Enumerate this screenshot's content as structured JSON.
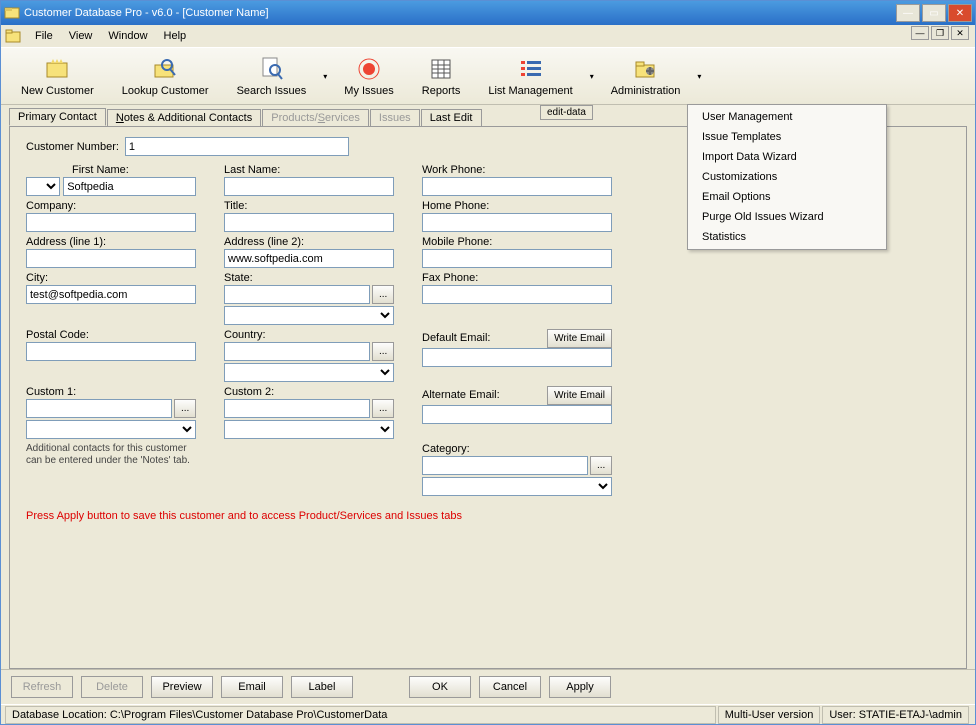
{
  "title": "Customer Database Pro - v6.0 - [Customer Name]",
  "menu": {
    "file": "File",
    "view": "View",
    "window": "Window",
    "help": "Help"
  },
  "toolbar": {
    "new_customer": "New Customer",
    "lookup_customer": "Lookup Customer",
    "search_issues": "Search Issues",
    "my_issues": "My Issues",
    "reports": "Reports",
    "list_management": "List Management",
    "administration": "Administration"
  },
  "tabs": {
    "primary": "Primary Contact",
    "notes": "Notes & Additional Contacts",
    "products": "Products/Services",
    "issues": "Issues",
    "last_edit": "Last Edit",
    "edit_data": "edit-data"
  },
  "admin_menu": {
    "user_mgmt": "User Management",
    "issue_templates": "Issue Templates",
    "import_wizard": "Import Data Wizard",
    "customizations": "Customizations",
    "email_options": "Email Options",
    "purge": "Purge Old Issues Wizard",
    "statistics": "Statistics"
  },
  "labels": {
    "customer_number": "Customer Number:",
    "first_name": "First Name:",
    "last_name": "Last Name:",
    "work_phone": "Work Phone:",
    "company": "Company:",
    "title": "Title:",
    "home_phone": "Home Phone:",
    "address1": "Address (line 1):",
    "address2": "Address (line 2):",
    "mobile_phone": "Mobile Phone:",
    "city": "City:",
    "state": "State:",
    "fax_phone": "Fax Phone:",
    "postal_code": "Postal Code:",
    "country": "Country:",
    "default_email": "Default Email:",
    "custom1": "Custom 1:",
    "custom2": "Custom 2:",
    "alternate_email": "Alternate Email:",
    "category": "Category:",
    "write_email": "Write Email",
    "ellipsis": "...",
    "additional_note": "Additional contacts for this customer can be entered under the 'Notes' tab.",
    "apply_msg": "Press Apply button to save this customer and to access Product/Services and Issues tabs"
  },
  "values": {
    "customer_number": "1",
    "first_name": "Softpedia",
    "address2": "www.softpedia.com",
    "city": "test@softpedia.com"
  },
  "buttons": {
    "refresh": "Refresh",
    "delete": "Delete",
    "preview": "Preview",
    "email": "Email",
    "label": "Label",
    "ok": "OK",
    "cancel": "Cancel",
    "apply": "Apply"
  },
  "status": {
    "db_location": "Database Location:  C:\\Program Files\\Customer Database Pro\\CustomerData",
    "version": "Multi-User version",
    "user": "User: STATIE-ETAJ-\\admin"
  }
}
